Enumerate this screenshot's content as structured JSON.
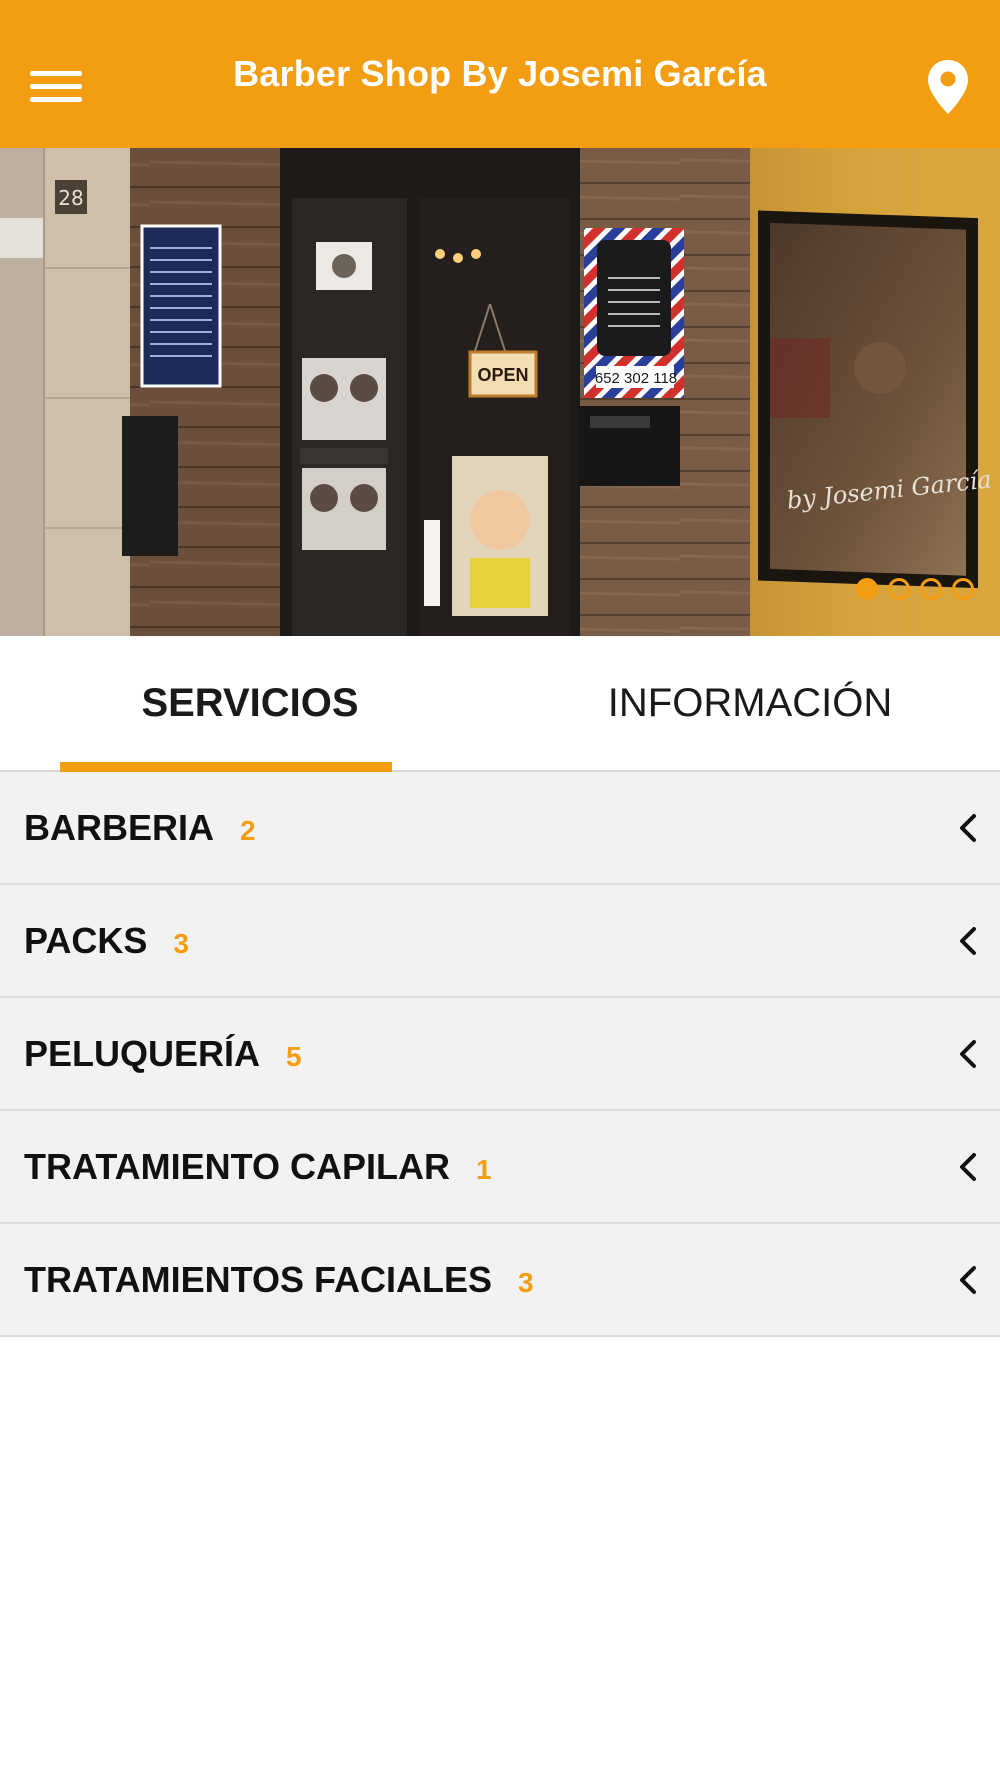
{
  "header": {
    "title": "Barber Shop By Josemi García",
    "menu_icon": "hamburger-menu-icon",
    "location_icon": "map-pin-icon"
  },
  "hero": {
    "street_number": "28",
    "door_sign": "OPEN",
    "phone_sign": "652 302 118",
    "window_text": "by Josemi García",
    "carousel_total": 4,
    "carousel_active_index": 0
  },
  "tabs": [
    {
      "label": "SERVICIOS",
      "active": true
    },
    {
      "label": "INFORMACIÓN",
      "active": false
    }
  ],
  "categories": [
    {
      "name": "BARBERIA",
      "count": "2"
    },
    {
      "name": "PACKS",
      "count": "3"
    },
    {
      "name": "PELUQUERÍA",
      "count": "5"
    },
    {
      "name": "TRATAMIENTO CAPILAR",
      "count": "1"
    },
    {
      "name": "TRATAMIENTOS FACIALES",
      "count": "3"
    }
  ],
  "colors": {
    "accent": "#f29d12",
    "row_background": "#f2f2f2",
    "text": "#111111"
  }
}
